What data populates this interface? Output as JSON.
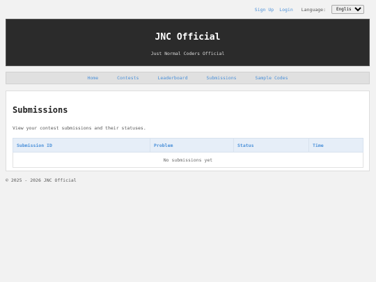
{
  "topbar": {
    "signup_label": "Sign Up",
    "login_label": "Login",
    "language_label": "Language:",
    "language_selected": "English"
  },
  "hero": {
    "title": "JNC Official",
    "tagline": "Just Normal Coders Official"
  },
  "nav": {
    "items": [
      "Home",
      "Contests",
      "Leaderboard",
      "Submissions",
      "Sample Codes"
    ]
  },
  "main": {
    "title": "Submissions",
    "description": "View your contest submissions and their statuses.",
    "table": {
      "columns": [
        "Submission ID",
        "Problem",
        "Status",
        "Time"
      ],
      "empty_message": "No submissions yet"
    }
  },
  "footer": {
    "text": "© 2025 - 2026 JNC Official"
  },
  "colors": {
    "link": "#4a90d9",
    "hero_bg": "#2b2b2b",
    "table_header_bg": "#e6eef8"
  }
}
